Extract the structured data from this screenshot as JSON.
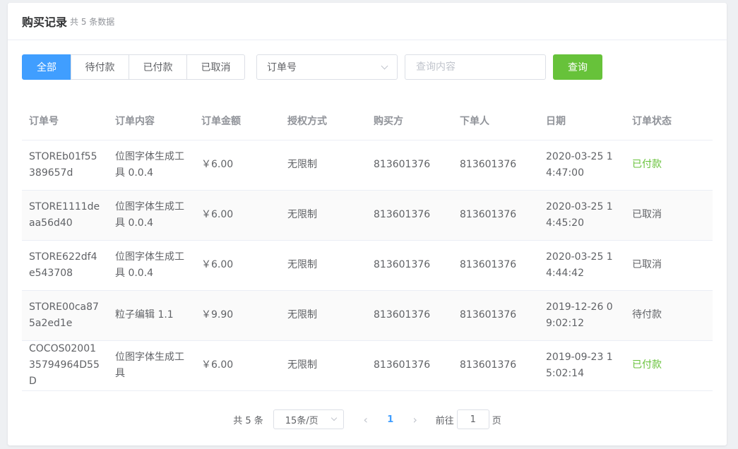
{
  "header": {
    "title": "购买记录",
    "count_text": "共 5 条数据"
  },
  "filters": {
    "tabs": [
      {
        "label": "全部",
        "active": true
      },
      {
        "label": "待付款",
        "active": false
      },
      {
        "label": "已付款",
        "active": false
      },
      {
        "label": "已取消",
        "active": false
      }
    ],
    "field_select": "订单号",
    "search_placeholder": "查询内容",
    "query_label": "查询"
  },
  "table": {
    "columns": [
      "订单号",
      "订单内容",
      "订单金额",
      "授权方式",
      "购买方",
      "下单人",
      "日期",
      "订单状态"
    ],
    "rows": [
      [
        "STOREb01f55389657d",
        "位图字体生成工具 0.0.4",
        "￥6.00",
        "无限制",
        "813601376",
        "813601376",
        "2020-03-25 14:47:00",
        "已付款"
      ],
      [
        "STORE1111deaa56d40",
        "位图字体生成工具 0.0.4",
        "￥6.00",
        "无限制",
        "813601376",
        "813601376",
        "2020-03-25 14:45:20",
        "已取消"
      ],
      [
        "STORE622df4e543708",
        "位图字体生成工具 0.0.4",
        "￥6.00",
        "无限制",
        "813601376",
        "813601376",
        "2020-03-25 14:44:42",
        "已取消"
      ],
      [
        "STORE00ca875a2ed1e",
        "粒子编辑 1.1",
        "￥9.90",
        "无限制",
        "813601376",
        "813601376",
        "2019-12-26 09:02:12",
        "待付款"
      ],
      [
        "COCOS0200135794964D55D",
        "位图字体生成工具",
        "￥6.00",
        "无限制",
        "813601376",
        "813601376",
        "2019-09-23 15:02:14",
        "已付款"
      ]
    ]
  },
  "pagination": {
    "total_text": "共 5 条",
    "page_size": "15条/页",
    "current_page": "1",
    "goto_prefix": "前往",
    "goto_value": "1",
    "goto_suffix": "页"
  },
  "colors": {
    "primary": "#409eff",
    "success": "#67c23a",
    "paid_status": "已付款"
  }
}
